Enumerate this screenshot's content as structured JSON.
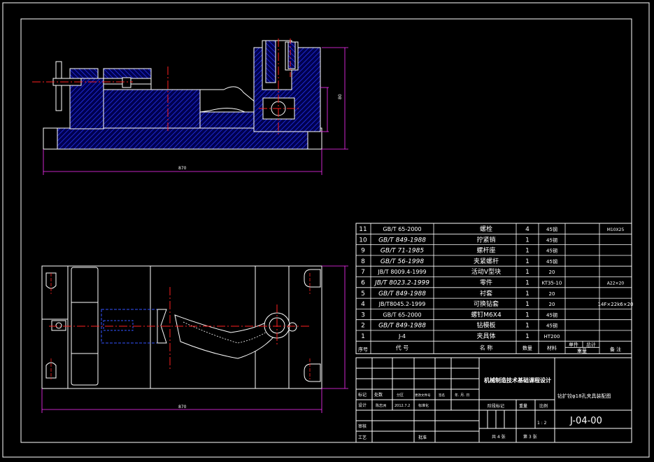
{
  "drawing": {
    "dimensions": {
      "top_width": "870",
      "top_height": "80",
      "bottom_width": "870"
    },
    "parts_list": {
      "rows": [
        {
          "no": "11",
          "code": "GB/T 65-2000",
          "name": "螺栓",
          "qty": "4",
          "material": "45钢",
          "weight": "",
          "note": "M10X25"
        },
        {
          "no": "10",
          "code": "GB/T 849-1988",
          "name": "拧紧销",
          "qty": "1",
          "material": "45钢",
          "weight": "",
          "note": ""
        },
        {
          "no": "9",
          "code": "GB/T 71-1985",
          "name": "螺杆座",
          "qty": "1",
          "material": "45钢",
          "weight": "",
          "note": ""
        },
        {
          "no": "8",
          "code": "GB/T 56-1998",
          "name": "夹紧螺杆",
          "qty": "1",
          "material": "45钢",
          "weight": "",
          "note": ""
        },
        {
          "no": "7",
          "code": "JB/T 8009.4-1999",
          "name": "活动V型块",
          "qty": "1",
          "material": "20",
          "weight": "",
          "note": ""
        },
        {
          "no": "6",
          "code": "JB/T 8023.2-1999",
          "name": "零件",
          "qty": "1",
          "material": "KT35-10",
          "weight": "",
          "note": "A22×20"
        },
        {
          "no": "5",
          "code": "GB/T 849-1988",
          "name": "衬套",
          "qty": "1",
          "material": "20",
          "weight": "",
          "note": ""
        },
        {
          "no": "4",
          "code": "JB/T8045.2-1999",
          "name": "可换钻套",
          "qty": "1",
          "material": "20",
          "weight": "",
          "note": "14F×22k6×20"
        },
        {
          "no": "3",
          "code": "GB/T 65-2000",
          "name": "螺钉M6X4",
          "qty": "1",
          "material": "45钢",
          "weight": "",
          "note": ""
        },
        {
          "no": "2",
          "code": "GB/T 849-1988",
          "name": "钻模板",
          "qty": "1",
          "material": "45钢",
          "weight": "",
          "note": ""
        },
        {
          "no": "1",
          "code": "J-4",
          "name": "夹具体",
          "qty": "1",
          "material": "HT200",
          "weight": "",
          "note": ""
        }
      ],
      "header": {
        "no": "序号",
        "code": "代  号",
        "name": "名    称",
        "qty": "数量",
        "material": "材料",
        "unit_weight": "单件",
        "total_weight": "总计",
        "weight": "重量",
        "note": "备  注"
      }
    },
    "title_block": {
      "school": "机械制造技术基础课程设计",
      "drawing_title": "钻扩铰φ18孔夹具装配图",
      "drawing_no": "J-04-00",
      "mark": "标记",
      "count": "处数",
      "zone": "分区",
      "change_doc": "更改文件号",
      "signature": "签名",
      "date_label": "年. 月. 日",
      "design": "设计",
      "designer": "陈志洲",
      "design_date": "2012.7.2",
      "standardize": "标准化",
      "stage_mark": "阶段标记",
      "weight": "重量",
      "scale": "比例",
      "scale_value": "1 : 2",
      "review": "审核",
      "process": "工艺",
      "approve": "批准",
      "sheets_total": "共 4 张",
      "sheet_no": "第 3 张"
    }
  }
}
